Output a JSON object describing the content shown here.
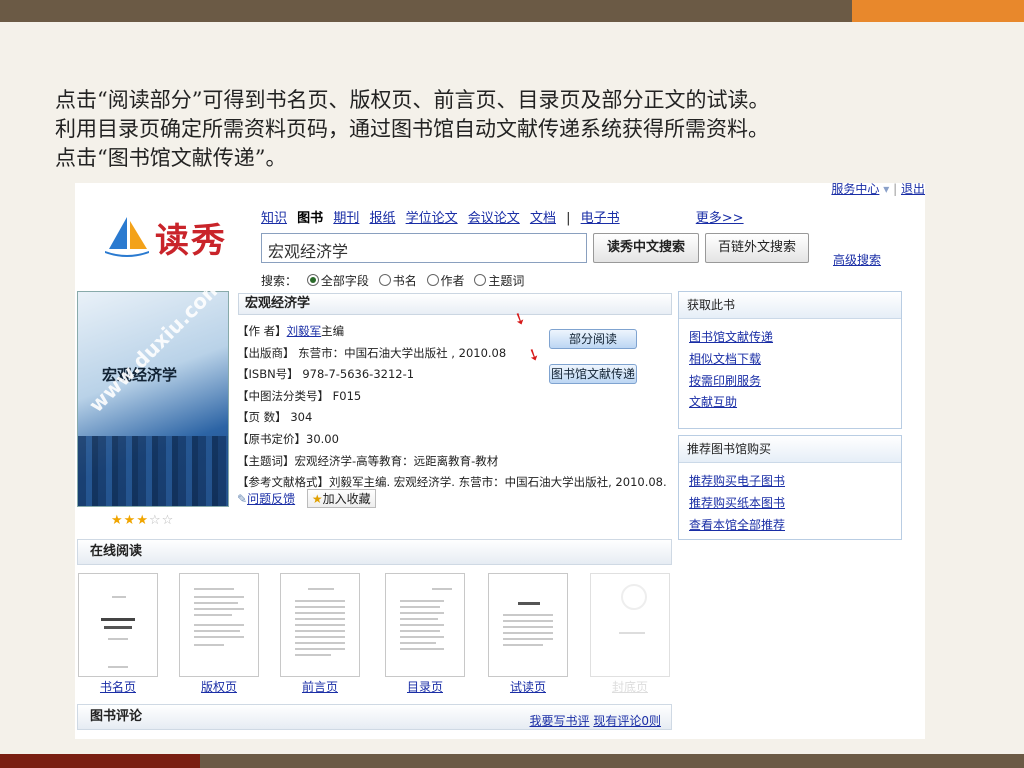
{
  "slide": {
    "intro_lines": [
      "点击“阅读部分”可得到书名页、版权页、前言页、目录页及部分正文的试读。",
      "利用目录页确定所需资料页码，通过图书馆自动文献传递系统获得所需资料。",
      "点击“图书馆文献传递”。"
    ]
  },
  "site": {
    "logo_text": "读秀",
    "top_links": {
      "service": "服务中心",
      "exit": "退出"
    },
    "nav": [
      "知识",
      "图书",
      "期刊",
      "报纸",
      "学位论文",
      "会议论文",
      "文档",
      "电子书",
      "更多>>"
    ],
    "search_value": "宏观经济学",
    "search_button": "读秀中文搜索",
    "external_button": "百链外文搜索",
    "advanced_link": "高级搜索",
    "search_label": "搜索：",
    "search_fields": [
      "全部字段",
      "书名",
      "作者",
      "主题词"
    ]
  },
  "book": {
    "title": "宏观经济学",
    "cover_title": "宏观经济学",
    "cover_watermark": "www.duxiu.com",
    "rating_stars": 3,
    "rows": [
      {
        "label": "【作 者】",
        "value": "刘毅军",
        "suffix": "主编"
      },
      {
        "label": "【出版商】",
        "value": "东营市：中国石油大学出版社 , 2010.08"
      },
      {
        "label": "【ISBN号】",
        "value": "978-7-5636-3212-1"
      },
      {
        "label": "【中图法分类号】",
        "value": "F015"
      },
      {
        "label": "【页 数】",
        "value": "304"
      },
      {
        "label": "【原书定价】",
        "value": "30.00"
      },
      {
        "label": "【主题词】",
        "value": "宏观经济学-高等教育：远距离教育-教材"
      },
      {
        "label": "【参考文献格式】",
        "value": "刘毅军主编. 宏观经济学. 东营市：中国石油大学出版社, 2010.08."
      }
    ],
    "partial_read_button": "部分阅读",
    "delivery_button": "图书馆文献传递",
    "feedback_link": "问题反馈",
    "favorite_button": "加入收藏"
  },
  "get_book": {
    "header": "获取此书",
    "links": [
      "图书馆文献传递",
      "相似文档下载",
      "按需印刷服务",
      "文献互助"
    ]
  },
  "recommend": {
    "header": "推荐图书馆购买",
    "links": [
      "推荐购买电子图书",
      "推荐购买纸本图书",
      "查看本馆全部推荐"
    ]
  },
  "online_reading": {
    "header": "在线阅读",
    "pages": [
      "书名页",
      "版权页",
      "前言页",
      "目录页",
      "试读页",
      "封底页"
    ]
  },
  "comments": {
    "header": "图书评论",
    "write_link": "我要写书评",
    "count_link": "现有评论0则"
  }
}
